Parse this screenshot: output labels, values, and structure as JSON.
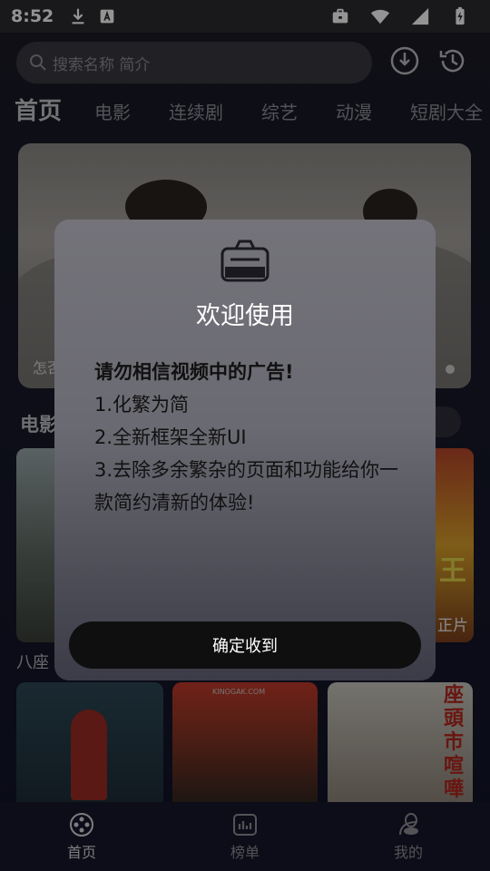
{
  "status_bar": {
    "time": "8:52"
  },
  "search": {
    "placeholder": "搜索名称 简介"
  },
  "tabs": [
    "首页",
    "电影",
    "连续剧",
    "综艺",
    "动漫",
    "短剧大全"
  ],
  "banner": {
    "caption": "怎否"
  },
  "section": {
    "title": "电影"
  },
  "posters": {
    "row1_left_label": "八座",
    "row1_right_label": "正片",
    "poster_right_text": "王",
    "poster_b1_text": "KINOGAK.COM",
    "poster_b2_text": "座頭市喧嘩太"
  },
  "dialog": {
    "title": "欢迎使用",
    "warning": "请勿相信视频中的广告!",
    "lines": [
      "1.化繁为简",
      "2.全新框架全新UI",
      "3.去除多余繁杂的页面和功能给你一款简约清新的体验!"
    ],
    "confirm": "确定收到"
  },
  "bottom_nav": [
    {
      "label": "首页",
      "icon": "film-reel-icon",
      "active": true
    },
    {
      "label": "榜单",
      "icon": "chart-icon",
      "active": false
    },
    {
      "label": "我的",
      "icon": "profile-icon",
      "active": false
    }
  ],
  "colors": {
    "background": "#0f1226",
    "dialog": "#6a6a72",
    "button": "#0f0f10"
  }
}
